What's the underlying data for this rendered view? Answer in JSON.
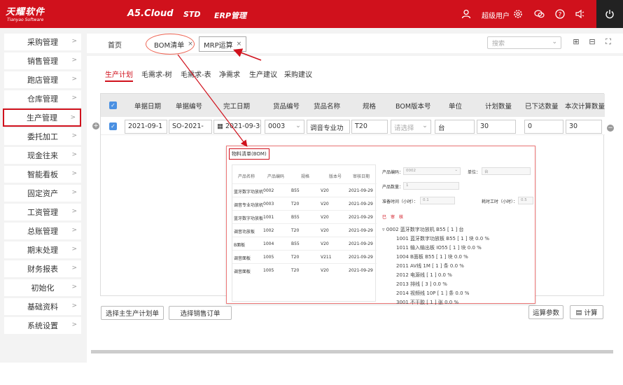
{
  "header": {
    "logo_cn": "天耀软件",
    "logo_en": "Tianyao Software",
    "nav": [
      "A5.Cloud",
      "STD",
      "ERP管理"
    ],
    "user": "超级用户"
  },
  "sidebar": {
    "items": [
      {
        "label": "采购管理"
      },
      {
        "label": "销售管理"
      },
      {
        "label": "跑店管理"
      },
      {
        "label": "仓库管理"
      },
      {
        "label": "生产管理"
      },
      {
        "label": "委托加工"
      },
      {
        "label": "现金往来"
      },
      {
        "label": "智能看板"
      },
      {
        "label": "固定资产"
      },
      {
        "label": "工资管理"
      },
      {
        "label": "总账管理"
      },
      {
        "label": "期末处理"
      },
      {
        "label": "财务报表"
      },
      {
        "label": "初始化"
      },
      {
        "label": "基础资料"
      },
      {
        "label": "系统设置"
      }
    ]
  },
  "tabs": {
    "home": "首页",
    "bom": "BOM清单",
    "mrp": "MRP运算",
    "close": "×"
  },
  "search": {
    "placeholder": "搜索"
  },
  "subtabs": [
    "生产计划",
    "毛需求-树",
    "毛需求-表",
    "净需求",
    "生产建议",
    "采购建议"
  ],
  "grid": {
    "headers": [
      "单据日期",
      "单据编号",
      "完工日期",
      "货品编号",
      "货品名称",
      "规格",
      "BOM版本号",
      "单位",
      "计划数量",
      "已下达数量",
      "本次计算数量"
    ],
    "row": {
      "date": "2021-09-1",
      "number": "SO-2021-",
      "finish": "2021-09-30",
      "code": "0003",
      "name": "调音专业功",
      "spec": "T20",
      "bom": "请选择",
      "unit": "台",
      "plan": "30",
      "issued": "0",
      "calc": "30"
    }
  },
  "buttons": {
    "select_plan": "选择主生产计划单",
    "select_order": "选择销售订单",
    "params": "运算参数",
    "calc": "计算"
  },
  "popup": {
    "title": "物料清单(BOM)",
    "left_headers": [
      "产品名称",
      "产品编码",
      "规格",
      "版本号",
      "审核日期"
    ],
    "left_rows": [
      [
        "蓝牙数字功放机",
        "0002",
        "B55",
        "V20",
        "2021-09-29"
      ],
      [
        "调音专业功放机",
        "0003",
        "T20",
        "V20",
        "2021-09-29"
      ],
      [
        "蓝牙数字功放板",
        "1001",
        "B55",
        "V20",
        "2021-09-29"
      ],
      [
        "调音功放板",
        "1002",
        "T20",
        "V20",
        "2021-09-29"
      ],
      [
        "B面板",
        "1004",
        "B55",
        "V20",
        "2021-09-29"
      ],
      [
        "调音面板",
        "1005",
        "T20",
        "V211",
        "2021-09-29"
      ],
      [
        "调音面板",
        "1005",
        "T20",
        "V20",
        "2021-09-29"
      ]
    ],
    "right": {
      "code_label": "产品编码：",
      "code_value": "0002",
      "unit_label": "单位：",
      "unit_value": "台",
      "qty_label": "产品数量：",
      "qty_value": "1",
      "prep_label": "准备时间（小时）：",
      "prep_value": "0.1",
      "work_label": "耗时工时（小时）：",
      "work_value": "0.5",
      "red_tags": "巳　审　核",
      "tree": [
        "0002 蓝牙数字功放机 B55 [ 1 ] 台",
        "1001 蓝牙数字功放板 B55 [ 1 ] 块 0.0 %",
        "1011 输入输出板 IO55 [ 1 ] 块 0.0 %",
        "1004 B面板 B55 [ 1 ] 块 0.0 %",
        "2011 AV线 1M [ 1 ] 条 0.0 %",
        "2012 电源线 [ 1 ] 0.0 %",
        "2013 排线 [ 3 ] 0.0 %",
        "2014 视频线 10P [ 1 ] 条 0.0 %",
        "3001 不干胶 [ 1 ] 张 0.0 %"
      ]
    }
  },
  "colors": {
    "brand_red": "#d0111c",
    "checkbox_blue": "#4a90e2"
  },
  "icons": [
    "user-icon",
    "gear-icon",
    "chat-icon",
    "help-icon",
    "speaker-icon",
    "power-icon",
    "plus-square-icon",
    "minimize-icon",
    "fullscreen-icon",
    "chevron-down-icon",
    "calendar-icon",
    "calculator-icon"
  ]
}
